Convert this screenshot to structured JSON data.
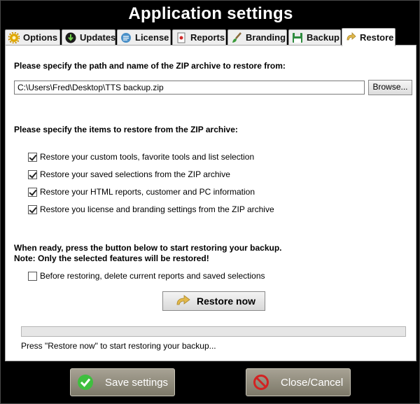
{
  "window": {
    "title": "Application settings"
  },
  "tabs": [
    {
      "label": "Options",
      "icon": "gear-icon"
    },
    {
      "label": "Updates",
      "icon": "download-icon"
    },
    {
      "label": "License",
      "icon": "license-icon"
    },
    {
      "label": "Reports",
      "icon": "report-icon"
    },
    {
      "label": "Branding",
      "icon": "paintbrush-icon"
    },
    {
      "label": "Backup",
      "icon": "floppy-disk-icon"
    },
    {
      "label": "Restore",
      "icon": "restore-arrow-icon",
      "active": true
    }
  ],
  "restore": {
    "path_prompt": "Please specify the path and name of the ZIP archive to restore from:",
    "path_value": "C:\\Users\\Fred\\Desktop\\TTS backup.zip",
    "browse_label": "Browse...",
    "items_prompt": "Please specify the items to restore from the ZIP archive:",
    "items": [
      {
        "label": "Restore your custom tools, favorite tools and list selection",
        "checked": true
      },
      {
        "label": "Restore your saved selections from the ZIP archive",
        "checked": true
      },
      {
        "label": "Restore your HTML reports, customer and PC information",
        "checked": true
      },
      {
        "label": "Restore you license and branding settings from the ZIP archive",
        "checked": true
      }
    ],
    "ready_line1": "When ready, press the button below to start restoring your backup.",
    "ready_line2": "Note: Only the selected features will be restored!",
    "delete_option": {
      "label": "Before restoring, delete current reports and saved selections",
      "checked": false
    },
    "restore_button": "Restore now",
    "progress": 0,
    "status": "Press \"Restore now\" to start restoring your backup..."
  },
  "footer": {
    "save_label": "Save settings",
    "close_label": "Close/Cancel"
  },
  "colors": {
    "background": "#000000",
    "panel": "#ffffff",
    "button_face": "#8f8b7d",
    "save_icon": "#3fbf3f",
    "cancel_icon": "#d32222"
  }
}
